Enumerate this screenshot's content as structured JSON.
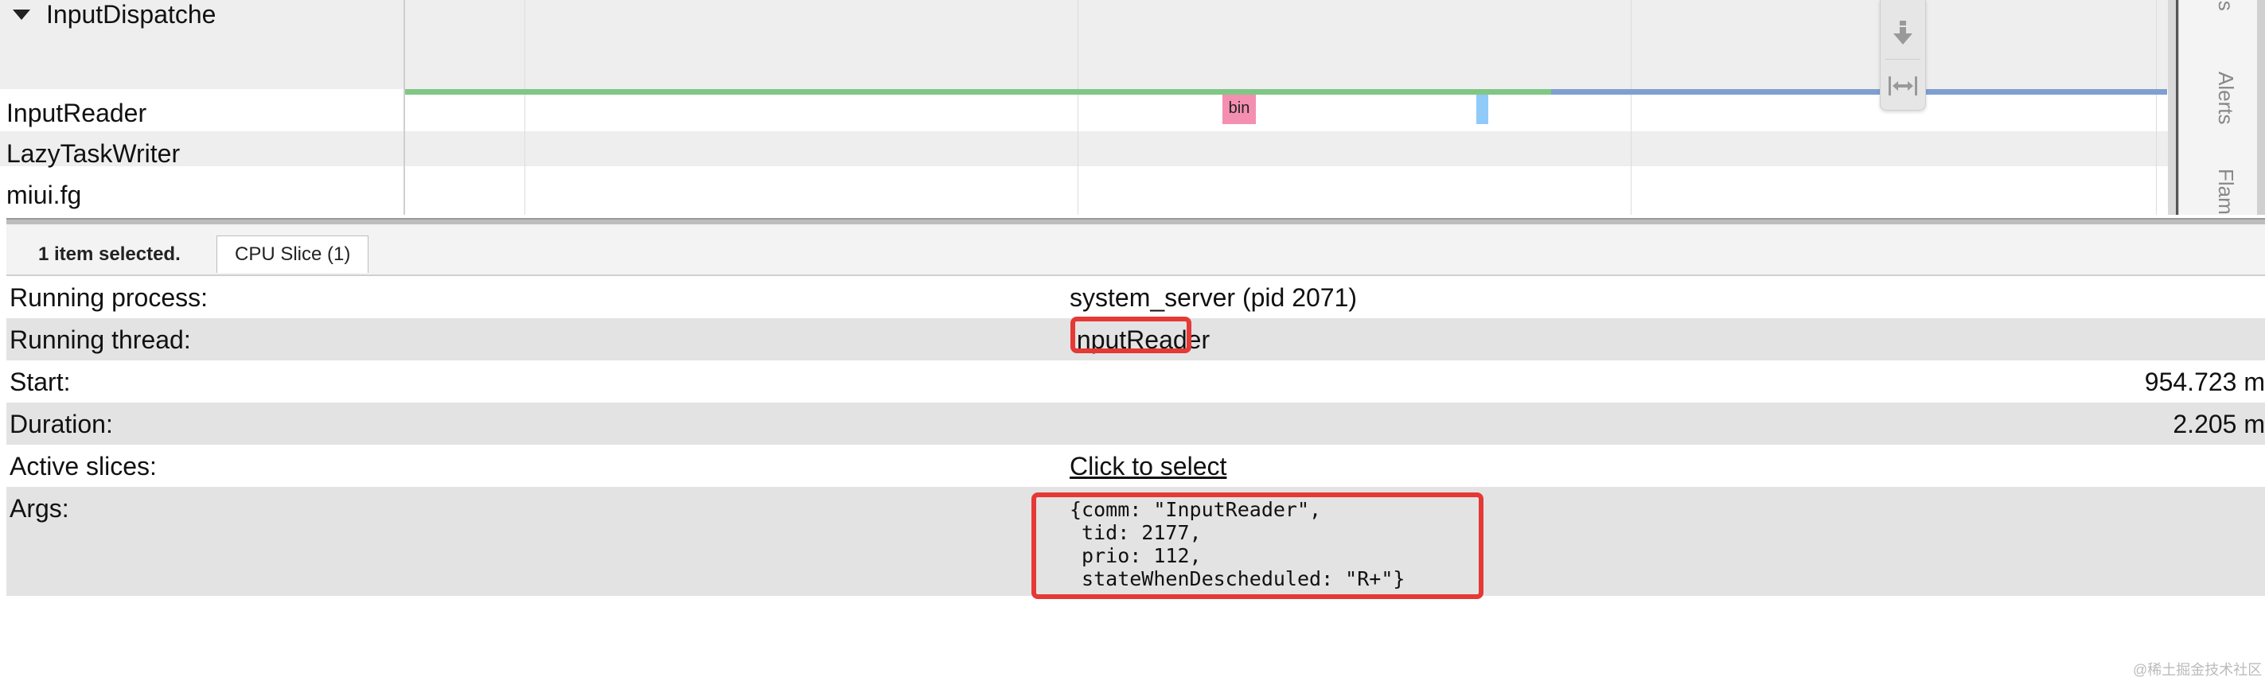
{
  "tracks": {
    "group_name": "InputDispatche",
    "rows": [
      "InputReader",
      "LazyTaskWriter",
      "miui.fg"
    ],
    "slice_label": "bin"
  },
  "toolbar": {
    "tool_1_icon": "down-arrow-icon",
    "tool_2_icon": "fit-width-icon"
  },
  "side_panel": {
    "labels": [
      "ics",
      "Alerts",
      "Flam"
    ]
  },
  "details": {
    "selection_text": "1 item selected.",
    "tab_label": "CPU Slice (1)",
    "rows": [
      {
        "label": "Running process:",
        "value": "system_server (pid 2071)"
      },
      {
        "label": "Running thread:",
        "value": "InputReader"
      },
      {
        "label": "Start:",
        "value": "954.723 m"
      },
      {
        "label": "Duration:",
        "value": "2.205 m"
      },
      {
        "label": "Active slices:",
        "value": "Click to select"
      },
      {
        "label": "Args:",
        "value": "{comm: \"InputReader\",\n tid: 2177,\n prio: 112,\n stateWhenDescheduled: \"R+\"}"
      }
    ]
  },
  "watermark": "@稀土掘金技术社区",
  "colors": {
    "running_state": "#81c784",
    "runnable_state": "#7e9fd1",
    "slice_pink": "#f48fb1",
    "slice_blue": "#90caf9",
    "highlight": "#e53935"
  }
}
